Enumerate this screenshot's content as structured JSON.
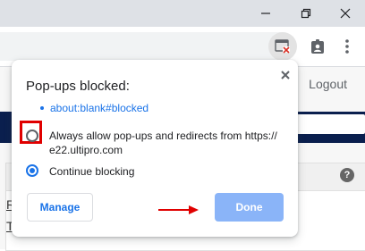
{
  "browser": {
    "window_controls": {
      "minimize_icon": "minimize-icon",
      "restore_icon": "restore-icon",
      "close_icon": "close-icon"
    },
    "toolbar": {
      "popup_blocked_icon": "popup-blocked-icon",
      "profile_icon": "profile-badge-icon",
      "menu_icon": "more-vert-icon"
    }
  },
  "page": {
    "logout_label": "Logout",
    "peek_letters": [
      "R",
      "T"
    ],
    "help_label": "?"
  },
  "popup_bubble": {
    "title": "Pop-ups blocked:",
    "blocked_link": "about:blank#blocked",
    "options": [
      {
        "label_line1": "Always allow pop-ups and redirects from https://",
        "label_line2": "e22.ultipro.com",
        "selected": false
      },
      {
        "label_line1": "Continue blocking",
        "selected": true
      }
    ],
    "manage_label": "Manage",
    "done_label": "Done"
  },
  "colors": {
    "accent": "#1a73e8",
    "done_button": "#8ab4f8",
    "annotation_red": "#e00000",
    "site_header": "#0a1f4e"
  }
}
